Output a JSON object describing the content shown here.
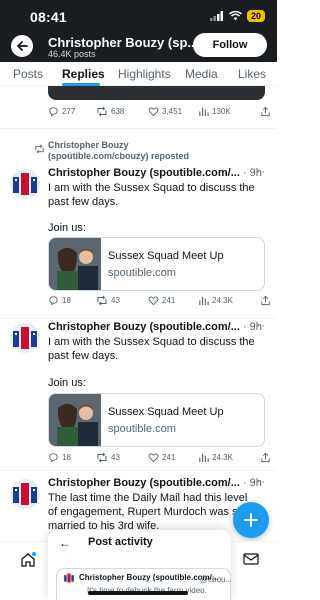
{
  "status_bar": {
    "time": "08:41",
    "battery": "20"
  },
  "header": {
    "name": "Christopher Bouzy (sp...",
    "posts": "46.4K posts",
    "follow_label": "Follow"
  },
  "tabs": [
    "Posts",
    "Replies",
    "Highlights",
    "Media",
    "Likes"
  ],
  "active_tab": "Replies",
  "top_post_actions": {
    "replies": "277",
    "reposts": "638",
    "likes": "3,451",
    "views": "130K"
  },
  "tweets": [
    {
      "reposted_by": "Christopher Bouzy (spoutible.com/cbouzy) reposted",
      "author": "Christopher Bouzy (spoutible.com/...",
      "time": "· 9h",
      "text": "I am with the Sussex Squad to discuss the past few days.",
      "join": "Join us:",
      "card": {
        "title": "Sussex Squad Meet Up",
        "domain": "spoutible.com"
      },
      "actions": {
        "replies": "18",
        "reposts": "43",
        "likes": "241",
        "views": "24.3K"
      }
    },
    {
      "author": "Christopher Bouzy (spoutible.com/...",
      "time": "· 9h",
      "text": "I am with the Sussex Squad to discuss the past few days.",
      "join": "Join us:",
      "card": {
        "title": "Sussex Squad Meet Up",
        "domain": "spoutible.com"
      },
      "actions": {
        "replies": "18",
        "reposts": "43",
        "likes": "241",
        "views": "24.3K"
      }
    },
    {
      "author": "Christopher Bouzy (spoutible.com/...",
      "time": "· 9h",
      "text": "The last time the Daily Mail had this level of engagement, Rupert Murdoch was still married to his 3rd wife."
    }
  ],
  "post_activity": {
    "title": "Post activity",
    "name": "Christopher Bouzy (spoutible.com/...",
    "handle": "@cbou...",
    "preview": "It's time to debunk the farm video."
  },
  "icons": {
    "back": "back-arrow-icon",
    "more": "more-icon",
    "reply": "reply-icon",
    "repost": "repost-icon",
    "like": "heart-icon",
    "views": "views-icon",
    "share": "share-icon",
    "compose": "plus-icon",
    "home": "home-icon",
    "communities": "communities-icon",
    "notifications": "bell-icon",
    "messages": "mail-icon"
  },
  "colors": {
    "accent": "#1d9bf0",
    "header_bg": "#1a1e23",
    "battery": "#f2c200"
  }
}
